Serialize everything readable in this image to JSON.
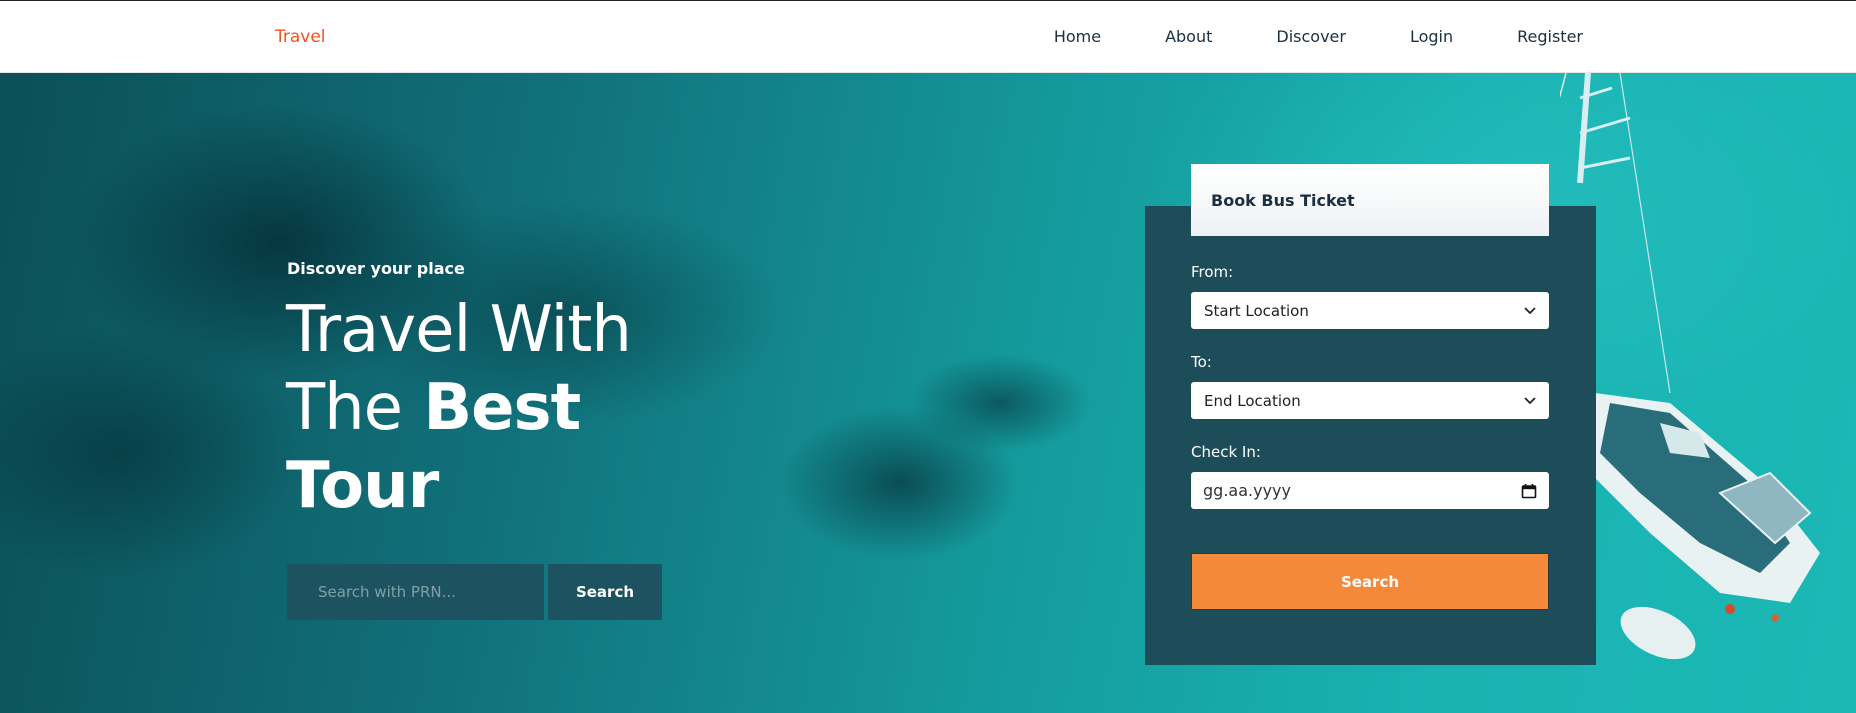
{
  "nav": {
    "brand": "Travel",
    "links": [
      "Home",
      "About",
      "Discover",
      "Login",
      "Register"
    ]
  },
  "hero": {
    "tagline": "Discover your place",
    "headline_line1": "Travel With",
    "headline_line2_light": "The",
    "headline_line2_bold": "Best",
    "headline_line3": "Tour",
    "prn_placeholder": "Search with PRN...",
    "prn_button": "Search",
    "social_icons": [
      "facebook-icon",
      "instagram-icon",
      "twitter-icon"
    ]
  },
  "booking": {
    "title": "Book Bus Ticket",
    "from_label": "From:",
    "from_value": "Start Location",
    "to_label": "To:",
    "to_value": "End Location",
    "checkin_label": "Check In:",
    "checkin_value": "gg.aa.yyyy",
    "search_button": "Search"
  },
  "colors": {
    "brand": "#f0531f",
    "panel": "#1d4d59",
    "accent_button": "#f5893a",
    "water": "#149a9c"
  }
}
